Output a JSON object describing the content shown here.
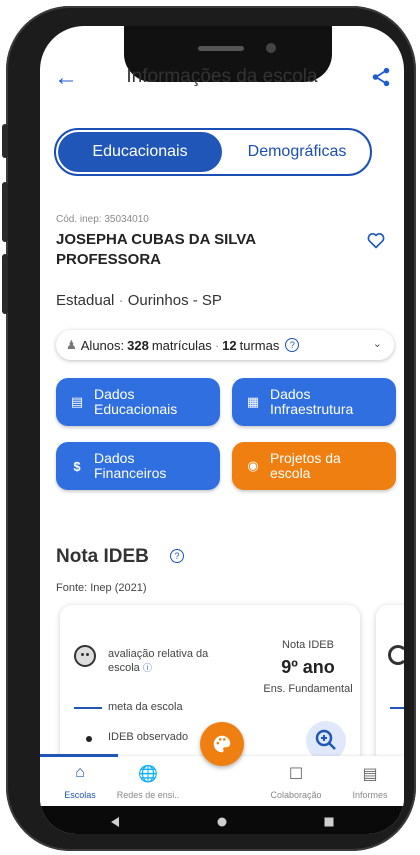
{
  "header": {
    "title": "Informações da escola",
    "back_icon": "arrow-left-icon",
    "share_icon": "share-icon"
  },
  "tabs": [
    {
      "label": "Educacionais",
      "selected": true
    },
    {
      "label": "Demográficas",
      "selected": false
    }
  ],
  "school": {
    "code": "Cód. inep: 35034010",
    "name": "JOSEPHA CUBAS DA SILVA PROFESSORA",
    "dependency": "Estadual",
    "location": "Ourinhos - SP"
  },
  "students": {
    "prefix": "Alunos:",
    "count": "328",
    "count_unit": "matrículas",
    "classes": "12",
    "classes_unit": "turmas"
  },
  "tiles": [
    {
      "label_line1": "Dados",
      "label_line2": "Educacionais",
      "icon": "id-card-icon",
      "color": "#2f6fe0"
    },
    {
      "label_line1": "Dados",
      "label_line2": "Infraestrutura",
      "icon": "building-icon",
      "color": "#2f6fe0"
    },
    {
      "label_line1": "Dados",
      "label_line2": "Financeiros",
      "icon": "dollar-icon",
      "color": "#2f6fe0"
    },
    {
      "label_line1": "Projetos da",
      "label_line2": "escola",
      "icon": "palette-icon",
      "color": "#f07f12"
    }
  ],
  "ideb": {
    "title": "Nota IDEB",
    "source": "Fonte: Inep (2021)",
    "card": {
      "relative": "avaliação relativa da escola",
      "meta": "meta da escola",
      "observed": "IDEB observado",
      "nota_label": "Nota IDEB",
      "grade": "9º ano",
      "level": "Ens. Fundamental"
    }
  },
  "bottom_nav": [
    {
      "label": "Escolas",
      "icon": "home-icon",
      "active": true
    },
    {
      "label": "Redes de ensi..",
      "icon": "globe-icon",
      "active": false
    },
    {
      "label": "Colaboração",
      "icon": "chat-icon",
      "active": false
    },
    {
      "label": "Informes",
      "icon": "newspaper-icon",
      "active": false
    }
  ],
  "colors": {
    "primary": "#1f56b8",
    "tile_blue": "#2f6fe0",
    "accent_orange": "#f07f12"
  }
}
